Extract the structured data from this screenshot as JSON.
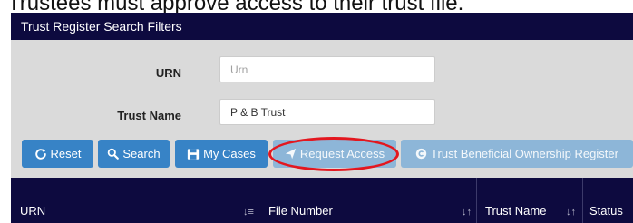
{
  "caption": "Trustees must approve access to their trust file.",
  "panel": {
    "title": "Trust Register Search Filters"
  },
  "filters": {
    "urn": {
      "label": "URN",
      "value": "",
      "placeholder": "Urn"
    },
    "trust_name": {
      "label": "Trust Name",
      "value": "P & B Trust",
      "placeholder": ""
    }
  },
  "buttons": {
    "reset": {
      "label": "Reset",
      "icon": "refresh-icon"
    },
    "search": {
      "label": "Search",
      "icon": "search-icon"
    },
    "my_cases": {
      "label": "My Cases",
      "icon": "briefcase-icon"
    },
    "request_access": {
      "label": "Request Access",
      "icon": "send-icon"
    },
    "tbor": {
      "label": "Trust Beneficial Ownership Register",
      "icon": "circle-copyright-icon"
    }
  },
  "table": {
    "columns": [
      {
        "label": "URN",
        "sort": "sort-alpha-icon"
      },
      {
        "label": "File Number",
        "sort": "sort-icon"
      },
      {
        "label": "Trust Name",
        "sort": "sort-icon"
      },
      {
        "label": "Status",
        "sort": ""
      }
    ]
  },
  "colors": {
    "header_bg": "#0d0a3f",
    "filter_bg": "#dadada",
    "button_primary": "#3783c6",
    "button_faded": "#8db6d8",
    "highlight_ellipse": "#e3171f"
  }
}
